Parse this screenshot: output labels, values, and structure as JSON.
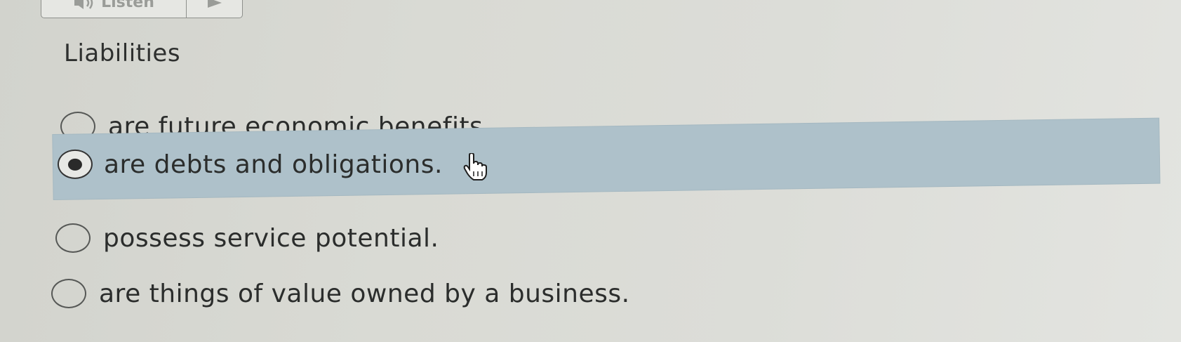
{
  "toolbar": {
    "listen_label": "Listen",
    "listen_icon": "speaker-icon",
    "play_icon": "play-icon"
  },
  "question": {
    "prompt": "Liabilities"
  },
  "choices": [
    {
      "label": "are future economic benefits.",
      "selected": false
    },
    {
      "label": "are debts and obligations.",
      "selected": true
    },
    {
      "label": "possess service potential.",
      "selected": false
    },
    {
      "label": "are things of value owned by a business.",
      "selected": false
    }
  ],
  "colors": {
    "selected_row": "#aec1ca",
    "background": "#d9dad4",
    "text": "#2b2d2c"
  },
  "cursor": "hand-pointer-icon"
}
